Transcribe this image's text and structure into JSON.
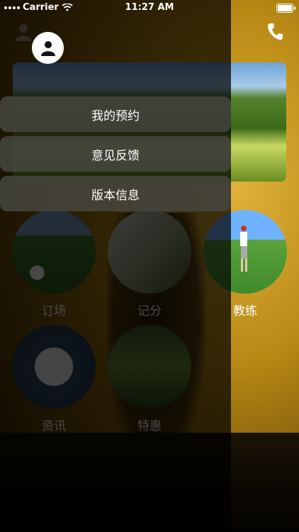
{
  "status_bar": {
    "carrier": "Carrier",
    "time": "11:27 AM"
  },
  "grid": {
    "items": [
      {
        "label": "订场"
      },
      {
        "label": "记分"
      },
      {
        "label": "教练"
      },
      {
        "label": "资讯"
      },
      {
        "label": "特惠"
      }
    ]
  },
  "drawer": {
    "menu": [
      {
        "label": "我的预约"
      },
      {
        "label": "意见反馈"
      },
      {
        "label": "版本信息"
      }
    ]
  },
  "icons": {
    "top_left": "user-icon",
    "top_right": "phone-icon",
    "drawer_avatar": "user-avatar-icon"
  },
  "colors": {
    "drawer_overlay": "#000000",
    "menu_item_bg": "#46463e",
    "background_accent": "#d4a62a"
  }
}
